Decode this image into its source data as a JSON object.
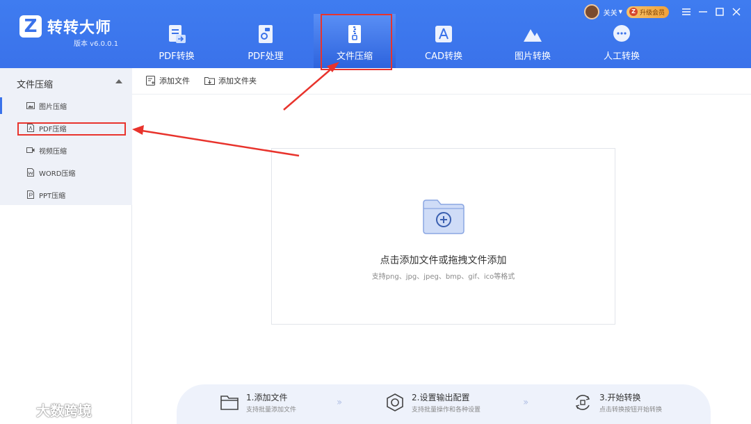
{
  "app": {
    "name": "转转大师",
    "version": "版本 v6.0.0.1"
  },
  "topbar": {
    "user_label": "关关",
    "vip_label": "升级会员"
  },
  "nav": {
    "tabs": [
      {
        "label": "PDF转换",
        "icon": "pdf-convert-icon"
      },
      {
        "label": "PDF处理",
        "icon": "pdf-process-icon"
      },
      {
        "label": "文件压缩",
        "icon": "zip-icon",
        "active": true
      },
      {
        "label": "CAD转换",
        "icon": "cad-icon"
      },
      {
        "label": "图片转换",
        "icon": "image-convert-icon"
      },
      {
        "label": "人工转换",
        "icon": "manual-convert-icon"
      }
    ]
  },
  "sidebar": {
    "title": "文件压缩",
    "items": [
      {
        "label": "图片压缩",
        "icon": "image-icon"
      },
      {
        "label": "PDF压缩",
        "icon": "pdf-icon"
      },
      {
        "label": "视频压缩",
        "icon": "video-icon"
      },
      {
        "label": "WORD压缩",
        "icon": "word-icon"
      },
      {
        "label": "PPT压缩",
        "icon": "ppt-icon"
      }
    ]
  },
  "toolbar": {
    "add_file": "添加文件",
    "add_folder": "添加文件夹"
  },
  "dropzone": {
    "title": "点击添加文件或拖拽文件添加",
    "subtitle": "支持png、jpg、jpeg、bmp、gif、ico等格式"
  },
  "steps": [
    {
      "title": "1.添加文件",
      "desc": "支持批量添加文件"
    },
    {
      "title": "2.设置输出配置",
      "desc": "支持批量操作和各种设置"
    },
    {
      "title": "3.开始转换",
      "desc": "点击转换按钮开始转换"
    }
  ],
  "watermark": "大数跨境",
  "colors": {
    "primary": "#3a72ea",
    "annotation_red": "#e8332c",
    "sidebar_bg": "#eef1f8"
  }
}
